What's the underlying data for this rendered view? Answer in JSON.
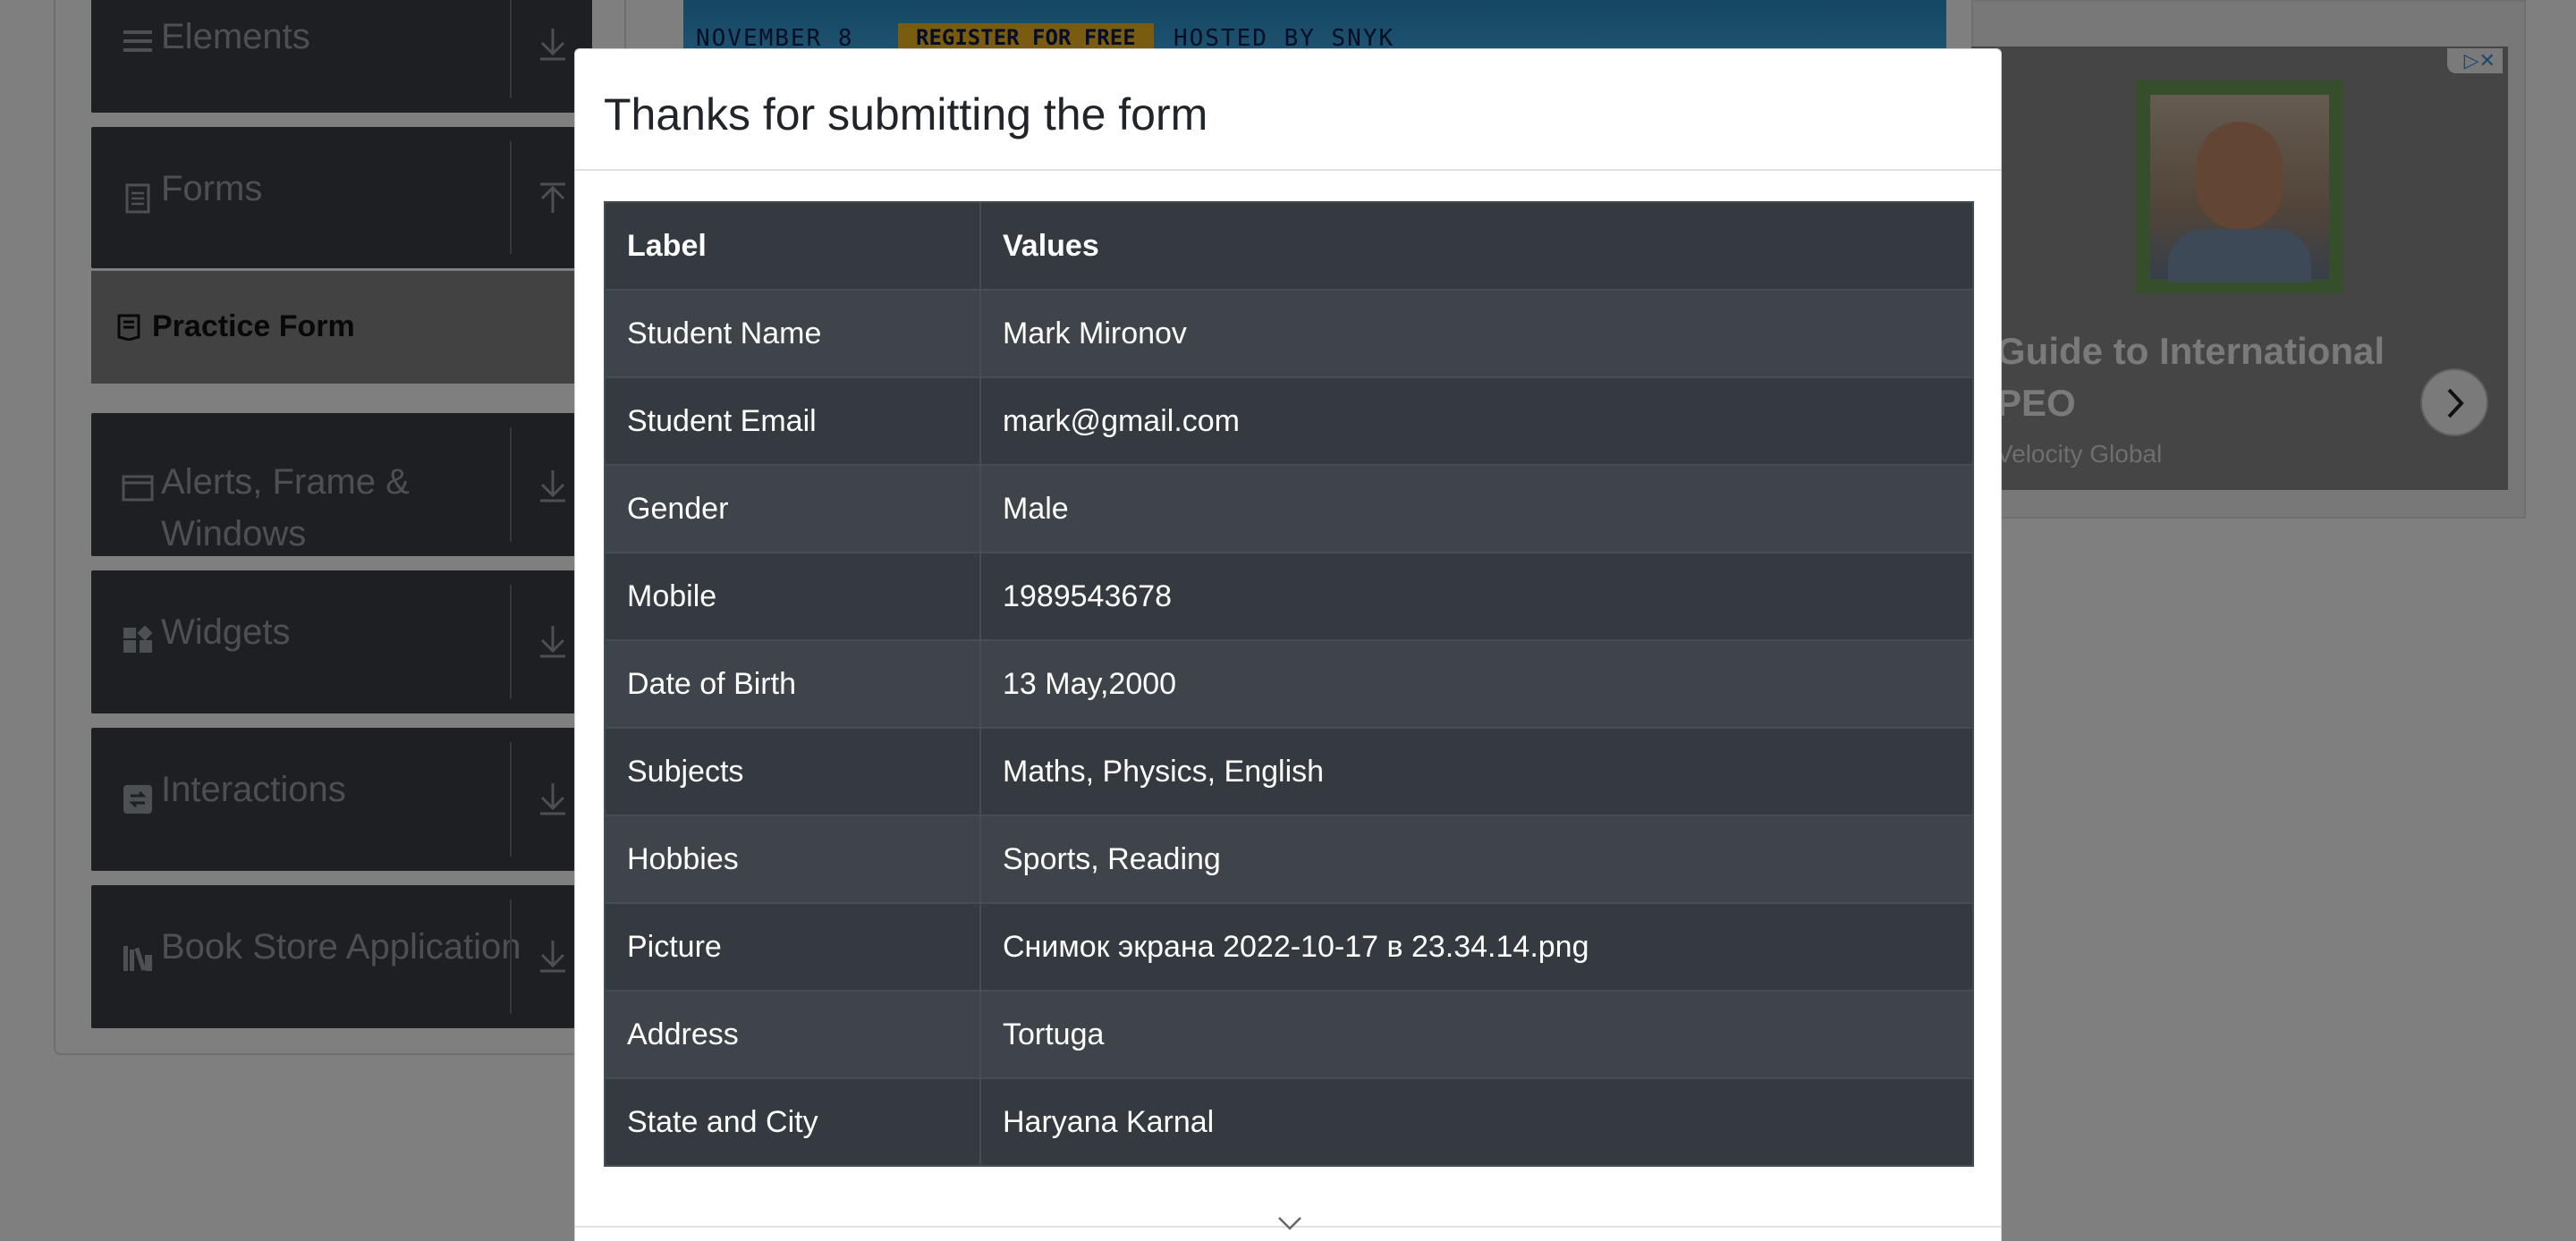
{
  "sidebar": {
    "groups": [
      {
        "label": "Elements",
        "icon": "hamburger-icon",
        "arrow": "download-arrow-icon"
      },
      {
        "label": "Forms",
        "icon": "document-icon",
        "arrow": "upload-arrow-icon"
      },
      {
        "label": "Alerts, Frame &",
        "label_line2": "Windows",
        "icon": "window-icon",
        "arrow": "download-arrow-icon"
      },
      {
        "label": "Widgets",
        "icon": "widgets-icon",
        "arrow": "download-arrow-icon"
      },
      {
        "label": "Interactions",
        "icon": "interactions-icon",
        "arrow": "download-arrow-icon"
      },
      {
        "label": "Book Store Application",
        "icon": "books-icon",
        "arrow": "download-arrow-icon"
      }
    ],
    "active_item": {
      "label": "Practice Form",
      "icon": "form-icon"
    }
  },
  "banner": {
    "date_text": "NOVEMBER 8",
    "register_text": "REGISTER FOR FREE",
    "hosted_text": "HOSTED BY SNYK"
  },
  "ad": {
    "headline_line1": "Guide to International",
    "headline_line2": "PEO",
    "brand": "Velocity Global",
    "adchoices_text": "▷✕"
  },
  "modal": {
    "title": "Thanks for submitting the form",
    "columns": [
      "Label",
      "Values"
    ],
    "rows": [
      {
        "label": "Student Name",
        "value": "Mark Mironov"
      },
      {
        "label": "Student Email",
        "value": "mark@gmail.com"
      },
      {
        "label": "Gender",
        "value": "Male"
      },
      {
        "label": "Mobile",
        "value": "1989543678"
      },
      {
        "label": "Date of Birth",
        "value": "13 May,2000"
      },
      {
        "label": "Subjects",
        "value": "Maths, Physics, English"
      },
      {
        "label": "Hobbies",
        "value": "Sports, Reading"
      },
      {
        "label": "Picture",
        "value": "Снимок экрана 2022-10-17 в 23.34.14.png"
      },
      {
        "label": "Address",
        "value": "Tortuga"
      },
      {
        "label": "State and City",
        "value": "Haryana Karnal"
      }
    ]
  },
  "colors": {
    "table_bg": "#343a40",
    "table_row_alt": "#3e444a",
    "overlay": "rgba(0,0,0,0.5)",
    "sidebar_item_bg": "#3b3e44"
  }
}
